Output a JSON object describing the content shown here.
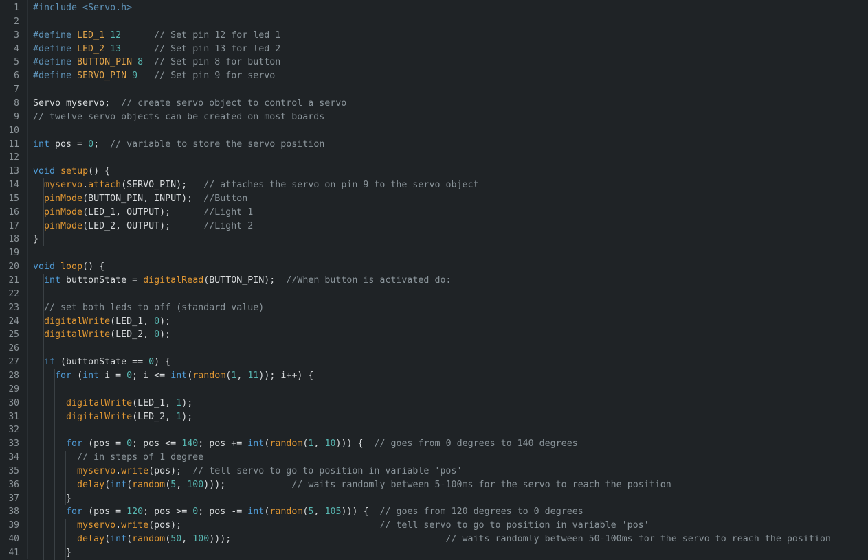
{
  "editor": {
    "language": "Arduino C++",
    "colors": {
      "background": "#1f2326",
      "line_number": "#8d959a",
      "keyword": "#4f9ad4",
      "function": "#e09733",
      "number": "#58b7b2",
      "comment": "#8a949a",
      "identifier": "#d7dadc",
      "preprocessor": "#5f93b8"
    },
    "lines": [
      {
        "n": "1",
        "tokens": [
          [
            "pp",
            "#include <Servo.h>"
          ]
        ]
      },
      {
        "n": "2",
        "tokens": []
      },
      {
        "n": "3",
        "tokens": [
          [
            "pp",
            "#define "
          ],
          [
            "mac",
            "LED_1"
          ],
          [
            "id",
            " "
          ],
          [
            "num",
            "12"
          ],
          [
            "id",
            "      "
          ],
          [
            "cm",
            "// Set pin 12 for led 1"
          ]
        ]
      },
      {
        "n": "4",
        "tokens": [
          [
            "pp",
            "#define "
          ],
          [
            "mac",
            "LED_2"
          ],
          [
            "id",
            " "
          ],
          [
            "num",
            "13"
          ],
          [
            "id",
            "      "
          ],
          [
            "cm",
            "// Set pin 13 for led 2"
          ]
        ]
      },
      {
        "n": "5",
        "tokens": [
          [
            "pp",
            "#define "
          ],
          [
            "mac",
            "BUTTON_PIN"
          ],
          [
            "id",
            " "
          ],
          [
            "num",
            "8"
          ],
          [
            "id",
            "  "
          ],
          [
            "cm",
            "// Set pin 8 for button"
          ]
        ]
      },
      {
        "n": "6",
        "tokens": [
          [
            "pp",
            "#define "
          ],
          [
            "mac",
            "SERVO_PIN"
          ],
          [
            "id",
            " "
          ],
          [
            "num",
            "9"
          ],
          [
            "id",
            "   "
          ],
          [
            "cm",
            "// Set pin 9 for servo"
          ]
        ]
      },
      {
        "n": "7",
        "tokens": []
      },
      {
        "n": "8",
        "tokens": [
          [
            "id",
            "Servo myservo;  "
          ],
          [
            "cm",
            "// create servo object to control a servo"
          ]
        ]
      },
      {
        "n": "9",
        "tokens": [
          [
            "cm",
            "// twelve servo objects can be created on most boards"
          ]
        ]
      },
      {
        "n": "10",
        "tokens": []
      },
      {
        "n": "11",
        "tokens": [
          [
            "kw",
            "int"
          ],
          [
            "id",
            " pos = "
          ],
          [
            "num",
            "0"
          ],
          [
            "id",
            ";  "
          ],
          [
            "cm",
            "// variable to store the servo position"
          ]
        ]
      },
      {
        "n": "12",
        "tokens": []
      },
      {
        "n": "13",
        "tokens": [
          [
            "kw",
            "void"
          ],
          [
            "id",
            " "
          ],
          [
            "fn",
            "setup"
          ],
          [
            "id",
            "() {"
          ]
        ]
      },
      {
        "n": "14",
        "tokens": [
          [
            "id",
            "  "
          ],
          [
            "fn",
            "myservo"
          ],
          [
            "id",
            "."
          ],
          [
            "fn",
            "attach"
          ],
          [
            "id",
            "(SERVO_PIN);   "
          ],
          [
            "cm",
            "// attaches the servo on pin 9 to the servo object"
          ]
        ]
      },
      {
        "n": "15",
        "tokens": [
          [
            "id",
            "  "
          ],
          [
            "fn",
            "pinMode"
          ],
          [
            "id",
            "(BUTTON_PIN, INPUT);  "
          ],
          [
            "cm",
            "//Button"
          ]
        ]
      },
      {
        "n": "16",
        "tokens": [
          [
            "id",
            "  "
          ],
          [
            "fn",
            "pinMode"
          ],
          [
            "id",
            "(LED_1, OUTPUT);      "
          ],
          [
            "cm",
            "//Light 1"
          ]
        ]
      },
      {
        "n": "17",
        "tokens": [
          [
            "id",
            "  "
          ],
          [
            "fn",
            "pinMode"
          ],
          [
            "id",
            "(LED_2, OUTPUT);      "
          ],
          [
            "cm",
            "//Light 2"
          ]
        ]
      },
      {
        "n": "18",
        "tokens": [
          [
            "id",
            "}"
          ]
        ]
      },
      {
        "n": "19",
        "tokens": []
      },
      {
        "n": "20",
        "tokens": [
          [
            "kw",
            "void"
          ],
          [
            "id",
            " "
          ],
          [
            "fn",
            "loop"
          ],
          [
            "id",
            "() {"
          ]
        ]
      },
      {
        "n": "21",
        "tokens": [
          [
            "id",
            "  "
          ],
          [
            "kw",
            "int"
          ],
          [
            "id",
            " buttonState = "
          ],
          [
            "fn",
            "digitalRead"
          ],
          [
            "id",
            "(BUTTON_PIN);  "
          ],
          [
            "cm",
            "//When button is activated do:"
          ]
        ]
      },
      {
        "n": "22",
        "tokens": []
      },
      {
        "n": "23",
        "tokens": [
          [
            "id",
            "  "
          ],
          [
            "cm",
            "// set both leds to off (standard value)"
          ]
        ]
      },
      {
        "n": "24",
        "tokens": [
          [
            "id",
            "  "
          ],
          [
            "fn",
            "digitalWrite"
          ],
          [
            "id",
            "(LED_1, "
          ],
          [
            "num",
            "0"
          ],
          [
            "id",
            ");"
          ]
        ]
      },
      {
        "n": "25",
        "tokens": [
          [
            "id",
            "  "
          ],
          [
            "fn",
            "digitalWrite"
          ],
          [
            "id",
            "(LED_2, "
          ],
          [
            "num",
            "0"
          ],
          [
            "id",
            ");"
          ]
        ]
      },
      {
        "n": "26",
        "tokens": []
      },
      {
        "n": "27",
        "tokens": [
          [
            "id",
            "  "
          ],
          [
            "kw",
            "if"
          ],
          [
            "id",
            " (buttonState == "
          ],
          [
            "num",
            "0"
          ],
          [
            "id",
            ") {"
          ]
        ]
      },
      {
        "n": "28",
        "tokens": [
          [
            "id",
            "    "
          ],
          [
            "kw",
            "for"
          ],
          [
            "id",
            " ("
          ],
          [
            "kw",
            "int"
          ],
          [
            "id",
            " i = "
          ],
          [
            "num",
            "0"
          ],
          [
            "id",
            "; i <= "
          ],
          [
            "kw",
            "int"
          ],
          [
            "id",
            "("
          ],
          [
            "fn",
            "random"
          ],
          [
            "id",
            "("
          ],
          [
            "num",
            "1"
          ],
          [
            "id",
            ", "
          ],
          [
            "num",
            "11"
          ],
          [
            "id",
            ")); i++) {"
          ]
        ]
      },
      {
        "n": "29",
        "tokens": []
      },
      {
        "n": "30",
        "tokens": [
          [
            "id",
            "      "
          ],
          [
            "fn",
            "digitalWrite"
          ],
          [
            "id",
            "(LED_1, "
          ],
          [
            "num",
            "1"
          ],
          [
            "id",
            ");"
          ]
        ]
      },
      {
        "n": "31",
        "tokens": [
          [
            "id",
            "      "
          ],
          [
            "fn",
            "digitalWrite"
          ],
          [
            "id",
            "(LED_2, "
          ],
          [
            "num",
            "1"
          ],
          [
            "id",
            ");"
          ]
        ]
      },
      {
        "n": "32",
        "tokens": []
      },
      {
        "n": "33",
        "tokens": [
          [
            "id",
            "      "
          ],
          [
            "kw",
            "for"
          ],
          [
            "id",
            " (pos = "
          ],
          [
            "num",
            "0"
          ],
          [
            "id",
            "; pos <= "
          ],
          [
            "num",
            "140"
          ],
          [
            "id",
            "; pos += "
          ],
          [
            "kw",
            "int"
          ],
          [
            "id",
            "("
          ],
          [
            "fn",
            "random"
          ],
          [
            "id",
            "("
          ],
          [
            "num",
            "1"
          ],
          [
            "id",
            ", "
          ],
          [
            "num",
            "10"
          ],
          [
            "id",
            "))) {  "
          ],
          [
            "cm",
            "// goes from 0 degrees to 140 degrees"
          ]
        ]
      },
      {
        "n": "34",
        "tokens": [
          [
            "id",
            "        "
          ],
          [
            "cm",
            "// in steps of 1 degree"
          ]
        ]
      },
      {
        "n": "35",
        "tokens": [
          [
            "id",
            "        "
          ],
          [
            "fn",
            "myservo"
          ],
          [
            "id",
            "."
          ],
          [
            "fn",
            "write"
          ],
          [
            "id",
            "(pos);  "
          ],
          [
            "cm",
            "// tell servo to go to position in variable 'pos'"
          ]
        ]
      },
      {
        "n": "36",
        "tokens": [
          [
            "id",
            "        "
          ],
          [
            "fn",
            "delay"
          ],
          [
            "id",
            "("
          ],
          [
            "kw",
            "int"
          ],
          [
            "id",
            "("
          ],
          [
            "fn",
            "random"
          ],
          [
            "id",
            "("
          ],
          [
            "num",
            "5"
          ],
          [
            "id",
            ", "
          ],
          [
            "num",
            "100"
          ],
          [
            "id",
            ")));            "
          ],
          [
            "cm",
            "// waits randomly between 5-100ms for the servo to reach the position"
          ]
        ]
      },
      {
        "n": "37",
        "tokens": [
          [
            "id",
            "      }"
          ]
        ]
      },
      {
        "n": "38",
        "tokens": [
          [
            "id",
            "      "
          ],
          [
            "kw",
            "for"
          ],
          [
            "id",
            " (pos = "
          ],
          [
            "num",
            "120"
          ],
          [
            "id",
            "; pos >= "
          ],
          [
            "num",
            "0"
          ],
          [
            "id",
            "; pos -= "
          ],
          [
            "kw",
            "int"
          ],
          [
            "id",
            "("
          ],
          [
            "fn",
            "random"
          ],
          [
            "id",
            "("
          ],
          [
            "num",
            "5"
          ],
          [
            "id",
            ", "
          ],
          [
            "num",
            "105"
          ],
          [
            "id",
            "))) {  "
          ],
          [
            "cm",
            "// goes from 120 degrees to 0 degrees"
          ]
        ]
      },
      {
        "n": "39",
        "tokens": [
          [
            "id",
            "        "
          ],
          [
            "fn",
            "myservo"
          ],
          [
            "id",
            "."
          ],
          [
            "fn",
            "write"
          ],
          [
            "id",
            "(pos);                                    "
          ],
          [
            "cm",
            "// tell servo to go to position in variable 'pos'"
          ]
        ]
      },
      {
        "n": "40",
        "tokens": [
          [
            "id",
            "        "
          ],
          [
            "fn",
            "delay"
          ],
          [
            "id",
            "("
          ],
          [
            "kw",
            "int"
          ],
          [
            "id",
            "("
          ],
          [
            "fn",
            "random"
          ],
          [
            "id",
            "("
          ],
          [
            "num",
            "50"
          ],
          [
            "id",
            ", "
          ],
          [
            "num",
            "100"
          ],
          [
            "id",
            ")));                                       "
          ],
          [
            "cm",
            "// waits randomly between 50-100ms for the servo to reach the position"
          ]
        ]
      },
      {
        "n": "41",
        "tokens": [
          [
            "id",
            "      }"
          ]
        ]
      }
    ]
  }
}
